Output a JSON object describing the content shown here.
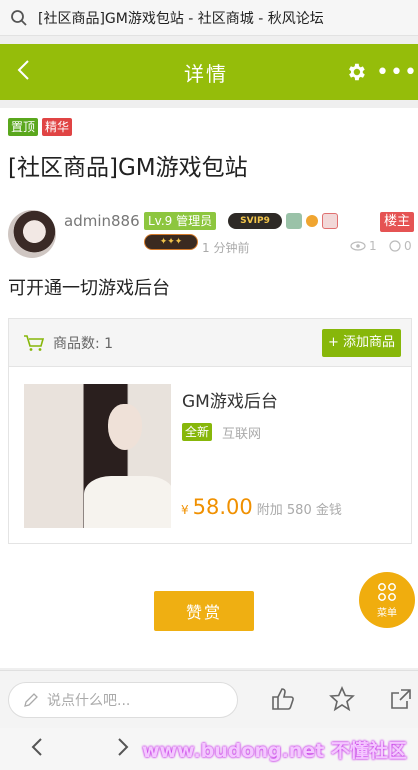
{
  "browser": {
    "page_title": "[社区商品]GM游戏包站 - 社区商城 - 秋风论坛",
    "search_icon": "search-icon"
  },
  "header": {
    "title": "详情",
    "back_icon": "chevron-left-icon",
    "settings_icon": "gear-icon",
    "more_icon": "more-dots-icon"
  },
  "thread": {
    "tags": [
      "置顶",
      "精华"
    ],
    "title": "[社区商品]GM游戏包站",
    "author": "admin886",
    "level_badge": "Lv.9 管理员",
    "medals": [
      "SVIP9"
    ],
    "floor_label": "楼主",
    "time": "1 分钟前",
    "views": "1",
    "replies": "0",
    "body": "可开通一切游戏后台"
  },
  "product_section": {
    "count_label": "商品数: 1",
    "add_button": "+ 添加商品",
    "cart_icon": "cart-icon"
  },
  "product": {
    "name": "GM游戏后台",
    "condition": "全新",
    "source": "互联网",
    "currency": "¥",
    "price": "58.00",
    "extra": "附加 580 金钱"
  },
  "actions": {
    "reward_button": "赞赏",
    "menu_label": "菜单"
  },
  "bottom_bar": {
    "comment_placeholder": "说点什么吧...",
    "like_icon": "thumbs-up-icon",
    "favorite_icon": "star-icon",
    "share_icon": "share-icon"
  },
  "browser_nav": {
    "back_icon": "nav-back-icon",
    "forward_icon": "nav-forward-icon"
  },
  "watermark": "www.budong.net 不懂社区",
  "colors": {
    "brand_green": "#95bd0a",
    "accent_orange": "#f09000",
    "top_tag": "#5aa71d",
    "best_tag": "#e04444"
  }
}
